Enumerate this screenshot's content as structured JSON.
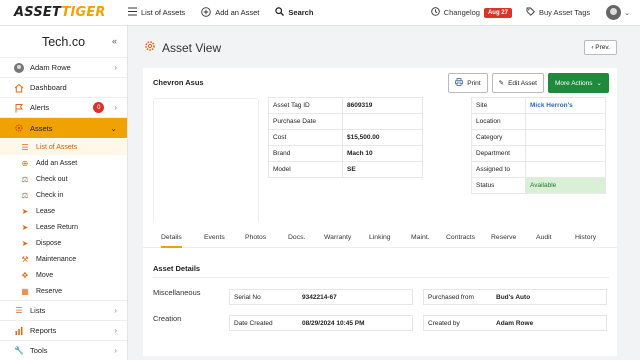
{
  "brand": {
    "part1": "ASSET",
    "part2": "TIGER"
  },
  "topnav": {
    "list_assets": "List of Assets",
    "add_asset": "Add an Asset",
    "search": "Search"
  },
  "topright": {
    "changelog": "Changelog",
    "changelog_badge": "Aug 27",
    "buy_tags": "Buy Asset Tags"
  },
  "sidebar": {
    "company": "Tech.co",
    "user": "Adam Rowe",
    "dashboard": "Dashboard",
    "alerts": "Alerts",
    "alerts_count": "0",
    "assets": "Assets",
    "sub": [
      "List of Assets",
      "Add an Asset",
      "Check out",
      "Check in",
      "Lease",
      "Lease Return",
      "Dispose",
      "Maintenance",
      "Move",
      "Reserve"
    ],
    "lists": "Lists",
    "reports": "Reports",
    "tools": "Tools"
  },
  "page": {
    "title": "Asset View",
    "prev": "Prev."
  },
  "asset": {
    "name": "Chevron Asus",
    "print": "Print",
    "edit": "Edit Asset",
    "more": "More Actions",
    "left": [
      {
        "k": "Asset Tag ID",
        "v": "8609319"
      },
      {
        "k": "Purchase Date",
        "v": ""
      },
      {
        "k": "Cost",
        "v": "$15,500.00"
      },
      {
        "k": "Brand",
        "v": "Mach 10"
      },
      {
        "k": "Model",
        "v": "SE"
      }
    ],
    "right": [
      {
        "k": "Site",
        "v": "Mick Herron's"
      },
      {
        "k": "Location",
        "v": ""
      },
      {
        "k": "Category",
        "v": ""
      },
      {
        "k": "Department",
        "v": ""
      },
      {
        "k": "Assigned to",
        "v": ""
      },
      {
        "k": "Status",
        "v": "Available"
      }
    ]
  },
  "tabs": [
    "Details",
    "Events",
    "Photos",
    "Docs.",
    "Warranty",
    "Linking",
    "Maint.",
    "Contracts",
    "Reserve",
    "Audit",
    "History"
  ],
  "details": {
    "heading": "Asset Details",
    "misc_label": "Miscellaneous",
    "creation_label": "Creation",
    "serial_k": "Serial No",
    "serial_v": "9342214-67",
    "purch_from_k": "Purchased from",
    "purch_from_v": "Bud's Auto",
    "date_created_k": "Date Created",
    "date_created_v": "08/29/2024 10:45 PM",
    "created_by_k": "Created by",
    "created_by_v": "Adam Rowe"
  },
  "colors": {
    "accent": "#f0a202",
    "green": "#1f8a3b",
    "red": "#d9342b",
    "link": "#2f6db5"
  }
}
